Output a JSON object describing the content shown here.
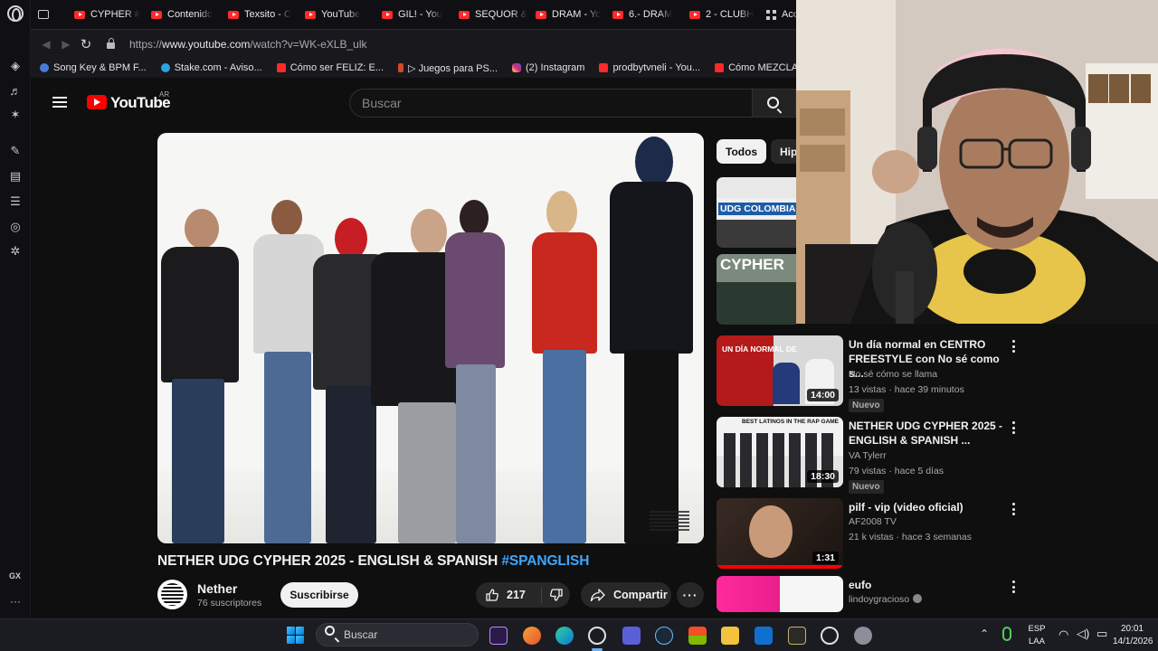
{
  "browser": {
    "tabs": [
      {
        "label": "",
        "icon": "tabs-icon"
      },
      {
        "label": "CYPHER #",
        "icon": "youtube-icon"
      },
      {
        "label": "Contenido",
        "icon": "youtube-icon"
      },
      {
        "label": "Texsito - C",
        "icon": "youtube-icon"
      },
      {
        "label": "YouTube",
        "icon": "youtube-icon"
      },
      {
        "label": "GIL! - You",
        "icon": "youtube-icon"
      },
      {
        "label": "SEQUOR &",
        "icon": "youtube-icon"
      },
      {
        "label": "DRAM - Yo",
        "icon": "youtube-icon"
      },
      {
        "label": "6.- DRAM",
        "icon": "youtube-icon"
      },
      {
        "label": "2 - CLUBH",
        "icon": "youtube-icon"
      },
      {
        "label": "Acc",
        "icon": "grid-icon"
      }
    ],
    "url_prefix": "https://",
    "url_host": "www.youtube.com",
    "url_path": "/watch?v=WK-eXLB_ulk",
    "bookmarks": [
      {
        "label": "Song Key & BPM F...",
        "color": "#4a7bd8"
      },
      {
        "label": "Stake.com - Aviso...",
        "color": "#2aa3e0"
      },
      {
        "label": "Cómo ser FELIZ: E...",
        "color": "#ff2a2a"
      },
      {
        "label": "▷ Juegos para PS...",
        "color": "#d04a2a"
      },
      {
        "label": "(2) Instagram",
        "color": "#d62976"
      },
      {
        "label": "prodbytvneli - You...",
        "color": "#ff2a2a"
      },
      {
        "label": "Cómo MEZCLAR T",
        "color": "#ff2a2a"
      }
    ],
    "sidebar_gx_label": "GX",
    "sidebar_more": "···"
  },
  "youtube": {
    "wordmark": "YouTube",
    "country_code": "AR",
    "search_placeholder": "Buscar",
    "video": {
      "title": "NETHER UDG CYPHER 2025 - ENGLISH & SPANISH ",
      "hashtag": "#SPANGLISH",
      "channel_name": "Nether",
      "subscribers": "76 suscriptores",
      "subscribe_label": "Suscribirse",
      "likes": "217",
      "share_label": "Compartir"
    },
    "chips": [
      "Todos",
      "Hip"
    ],
    "recommendations": [
      {
        "title": "Un día normal en CENTRO FREESTYLE con No sé como s...",
        "channel": "No sé cómo se llama",
        "meta": "13 vistas · hace 39 minutos",
        "duration": "14:00",
        "badge": "Nuevo",
        "thumb_text": "UN DÍA NORMAL DE",
        "verified": false
      },
      {
        "title": "NETHER UDG CYPHER 2025 - ENGLISH & SPANISH ...",
        "channel": "VA Tylerr",
        "meta": "79 vistas · hace 5 días",
        "duration": "18:30",
        "badge": "Nuevo",
        "thumb_text": "BEST LATINOS IN THE RAP GAME",
        "verified": false
      },
      {
        "title": "pilf - vip (video oficial)",
        "channel": "AF2008 TV",
        "meta": "21 k vistas · hace 3 semanas",
        "duration": "1:31",
        "badge": "",
        "thumb_text": "",
        "verified": false
      },
      {
        "title": "eufo",
        "channel": "lindoygracioso",
        "meta": "",
        "duration": "",
        "badge": "",
        "thumb_text": "",
        "verified": true
      }
    ],
    "upper_thumbs": [
      {
        "text": "UDG COLOMBIA CYP"
      },
      {
        "text": "CYPHER"
      }
    ]
  },
  "taskbar": {
    "search_placeholder": "Buscar",
    "lang_line1": "ESP",
    "lang_line2": "LAA",
    "time": "20:01",
    "date": "14/1/2026"
  }
}
